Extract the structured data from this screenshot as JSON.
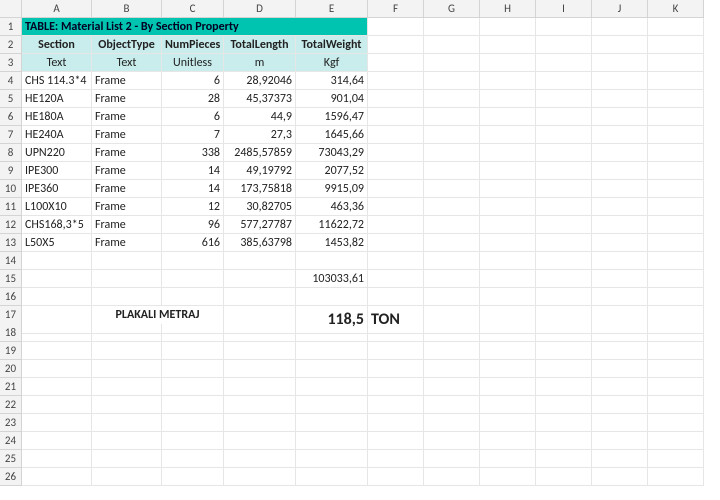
{
  "columns": [
    "A",
    "B",
    "C",
    "D",
    "E",
    "F",
    "G",
    "H",
    "I",
    "J",
    "K"
  ],
  "title": "TABLE:  Material List 2 - By Section Property",
  "headers": [
    "Section",
    "ObjectType",
    "NumPieces",
    "TotalLength",
    "TotalWeight"
  ],
  "units": [
    "Text",
    "Text",
    "Unitless",
    "m",
    "Kgf"
  ],
  "rows": [
    {
      "section": "CHS 114.3*4",
      "objtype": "Frame",
      "num": "6",
      "len": "28,92046",
      "wt": "314,64"
    },
    {
      "section": "HE120A",
      "objtype": "Frame",
      "num": "28",
      "len": "45,37373",
      "wt": "901,04"
    },
    {
      "section": "HE180A",
      "objtype": "Frame",
      "num": "6",
      "len": "44,9",
      "wt": "1596,47"
    },
    {
      "section": "HE240A",
      "objtype": "Frame",
      "num": "7",
      "len": "27,3",
      "wt": "1645,66"
    },
    {
      "section": "UPN220",
      "objtype": "Frame",
      "num": "338",
      "len": "2485,57859",
      "wt": "73043,29"
    },
    {
      "section": "IPE300",
      "objtype": "Frame",
      "num": "14",
      "len": "49,19792",
      "wt": "2077,52"
    },
    {
      "section": "IPE360",
      "objtype": "Frame",
      "num": "14",
      "len": "173,75818",
      "wt": "9915,09"
    },
    {
      "section": "L100X10",
      "objtype": "Frame",
      "num": "12",
      "len": "30,82705",
      "wt": "463,36"
    },
    {
      "section": "CHS168,3*5",
      "objtype": "Frame",
      "num": "96",
      "len": "577,27787",
      "wt": "11622,72"
    },
    {
      "section": "L50X5",
      "objtype": "Frame",
      "num": "616",
      "len": "385,63798",
      "wt": "1453,82"
    }
  ],
  "sum_weight": "103033,61",
  "footer_label": "PLAKALI METRAJ",
  "footer_value": "118,5",
  "footer_unit": "TON",
  "chart_data": {
    "type": "table",
    "title": "Material List 2 - By Section Property",
    "columns": [
      "Section",
      "ObjectType",
      "NumPieces",
      "TotalLength (m)",
      "TotalWeight (Kgf)"
    ],
    "data": [
      [
        "CHS 114.3*4",
        "Frame",
        6,
        28.92046,
        314.64
      ],
      [
        "HE120A",
        "Frame",
        28,
        45.37373,
        901.04
      ],
      [
        "HE180A",
        "Frame",
        6,
        44.9,
        1596.47
      ],
      [
        "HE240A",
        "Frame",
        7,
        27.3,
        1645.66
      ],
      [
        "UPN220",
        "Frame",
        338,
        2485.57859,
        73043.29
      ],
      [
        "IPE300",
        "Frame",
        14,
        49.19792,
        2077.52
      ],
      [
        "IPE360",
        "Frame",
        14,
        173.75818,
        9915.09
      ],
      [
        "L100X10",
        "Frame",
        12,
        30.82705,
        463.36
      ],
      [
        "CHS168,3*5",
        "Frame",
        96,
        577.27787,
        11622.72
      ],
      [
        "L50X5",
        "Frame",
        616,
        385.63798,
        1453.82
      ]
    ],
    "total_weight_kgf": 103033.61,
    "plakali_metraj_ton": 118.5
  }
}
